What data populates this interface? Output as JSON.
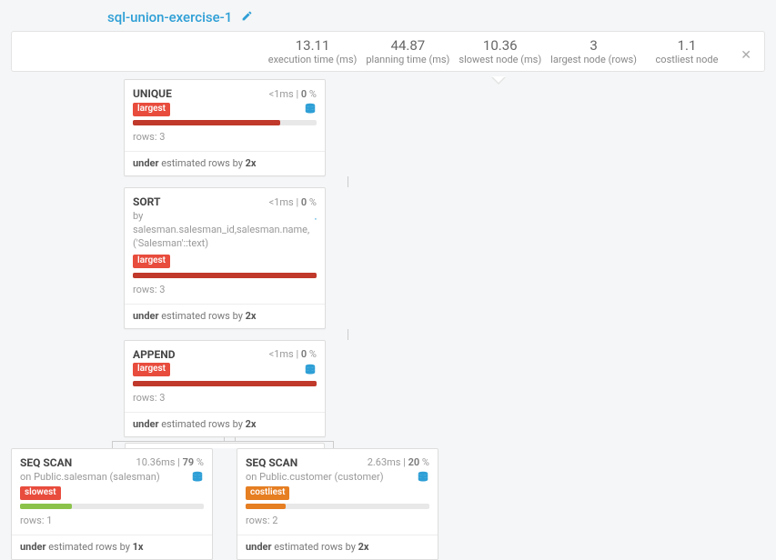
{
  "title": "sql-union-exercise-1",
  "metrics": {
    "execution_time": {
      "value": "13.11",
      "label": "execution time (ms)"
    },
    "planning_time": {
      "value": "44.87",
      "label": "planning time (ms)"
    },
    "slowest_node": {
      "value": "10.36",
      "label": "slowest node (ms)"
    },
    "largest_node": {
      "value": "3",
      "label": "largest node (rows)"
    },
    "costliest_node": {
      "value": "1.1",
      "label": "costliest node"
    }
  },
  "nodes": {
    "unique": {
      "name": "UNIQUE",
      "timing": "<1ms",
      "percent": "0",
      "badge": "largest",
      "bar_width": "80%",
      "bar_color": "red",
      "rows": "rows: 3",
      "est_prefix": "under",
      "est_mid": " estimated rows by ",
      "est_factor": "2x"
    },
    "sort": {
      "name": "SORT",
      "timing": "<1ms",
      "percent": "0",
      "sub": "by salesman.salesman_id,salesman.name,('Salesman'::text)",
      "badge": "largest",
      "bar_width": "100%",
      "bar_color": "red",
      "rows": "rows: 3",
      "est_prefix": "under",
      "est_mid": " estimated rows by ",
      "est_factor": "2x"
    },
    "append": {
      "name": "APPEND",
      "timing": "<1ms",
      "percent": "0",
      "badge": "largest",
      "bar_width": "100%",
      "bar_color": "red",
      "rows": "rows: 3",
      "est_prefix": "under",
      "est_mid": " estimated rows by ",
      "est_factor": "2x"
    },
    "seq1": {
      "name": "SEQ SCAN",
      "timing": "10.36ms",
      "percent": "79",
      "sub": "on Public.salesman (salesman)",
      "badge": "slowest",
      "bar_width": "28%",
      "bar_color": "green",
      "rows": "rows: 1",
      "est_prefix": "under",
      "est_mid": " estimated rows by ",
      "est_factor": "1x"
    },
    "seq2": {
      "name": "SEQ SCAN",
      "timing": "2.63ms",
      "percent": "20",
      "sub": "on Public.customer (customer)",
      "badge": "costliest",
      "bar_width": "22%",
      "bar_color": "orange",
      "rows": "rows: 2",
      "est_prefix": "under",
      "est_mid": " estimated rows by ",
      "est_factor": "2x"
    }
  }
}
